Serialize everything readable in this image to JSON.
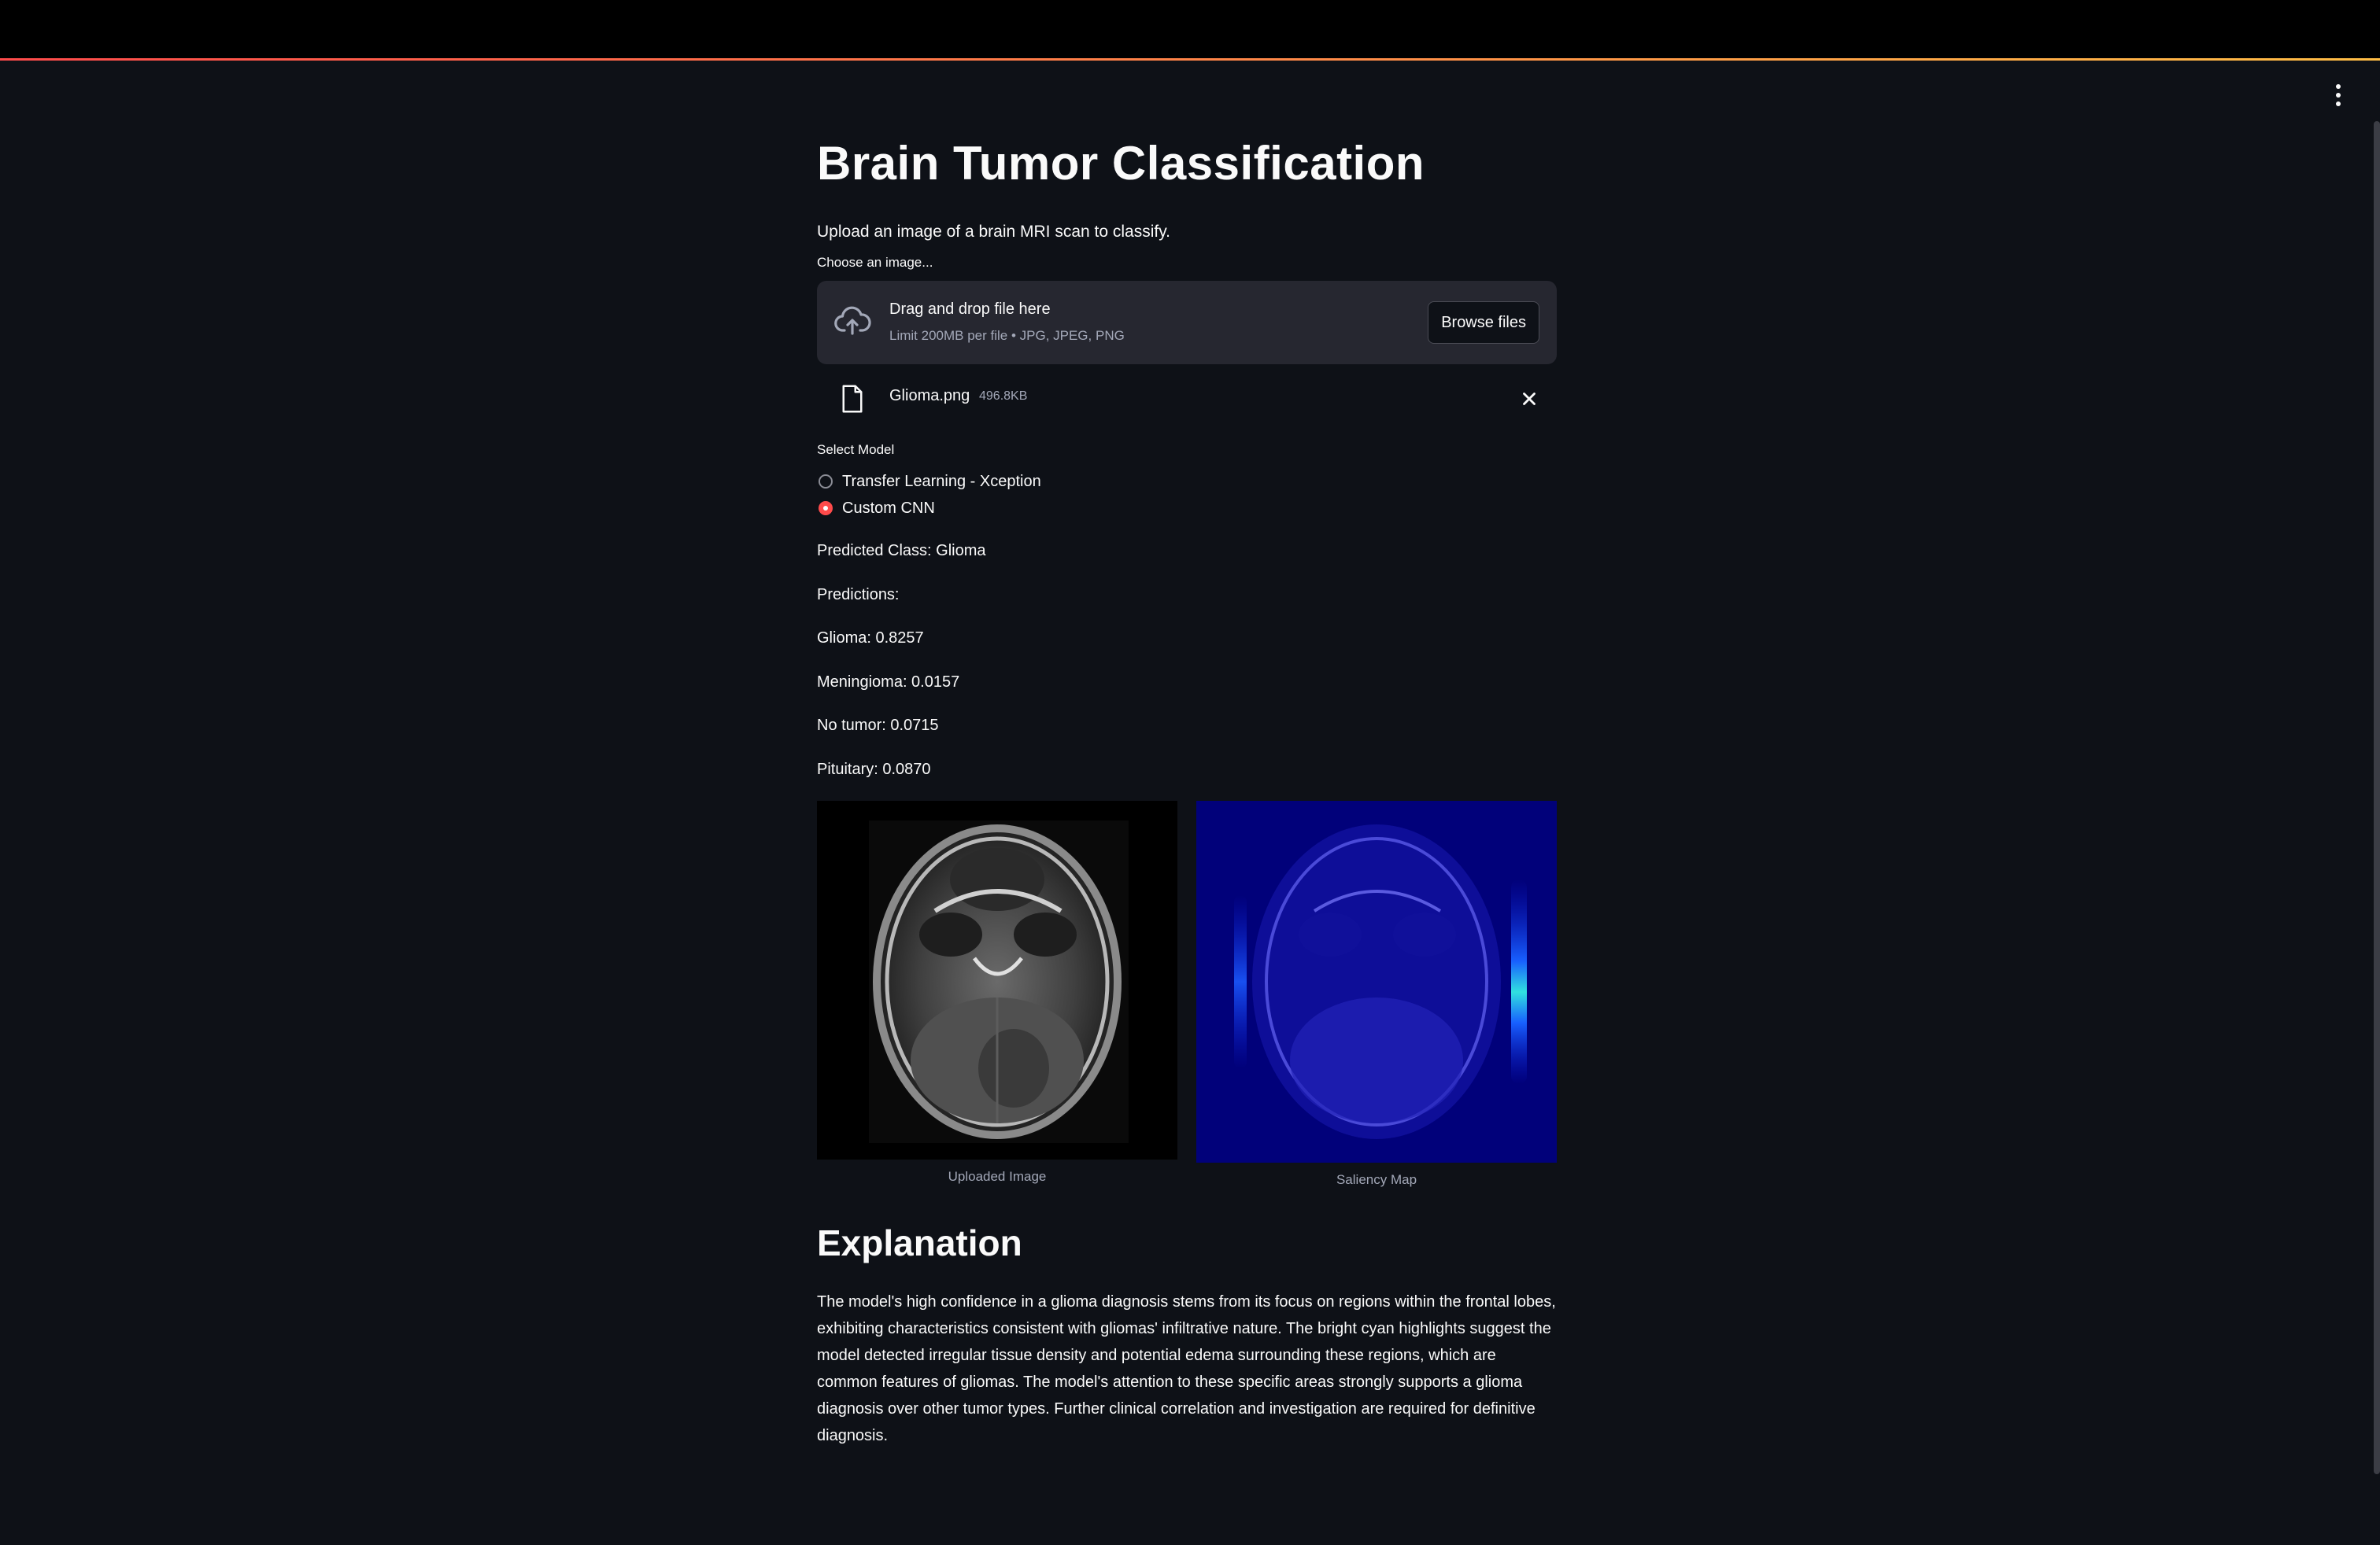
{
  "app": {
    "title": "Brain Tumor Classification",
    "subtitle": "Upload an image of a brain MRI scan to classify.",
    "accent_color": "#ff4b4b",
    "background_color": "#0e1117"
  },
  "uploader": {
    "label": "Choose an image...",
    "drop_text": "Drag and drop file here",
    "limit_text": "Limit 200MB per file • JPG, JPEG, PNG",
    "browse_label": "Browse files",
    "file": {
      "name": "Glioma.png",
      "size": "496.8KB"
    }
  },
  "model_select": {
    "label": "Select Model",
    "options": [
      {
        "label": "Transfer Learning - Xception",
        "selected": false
      },
      {
        "label": "Custom CNN",
        "selected": true
      }
    ]
  },
  "results": {
    "predicted_class": "Predicted Class: Glioma",
    "predictions_header": "Predictions:",
    "lines": [
      "Glioma: 0.8257",
      "Meningioma: 0.0157",
      "No tumor: 0.0715",
      "Pituitary: 0.0870"
    ]
  },
  "images": {
    "uploaded_caption": "Uploaded Image",
    "saliency_caption": "Saliency Map"
  },
  "explanation": {
    "heading": "Explanation",
    "text": "The model's high confidence in a glioma diagnosis stems from its focus on regions within the frontal lobes, exhibiting characteristics consistent with gliomas' infiltrative nature. The bright cyan highlights suggest the model detected irregular tissue density and potential edema surrounding these regions, which are common features of gliomas. The model's attention to these specific areas strongly supports a glioma diagnosis over other tumor types. Further clinical correlation and investigation are required for definitive diagnosis."
  },
  "icons": {
    "upload": "cloud-upload-icon",
    "file": "file-icon",
    "close": "close-icon",
    "menu": "more-vertical-icon"
  }
}
